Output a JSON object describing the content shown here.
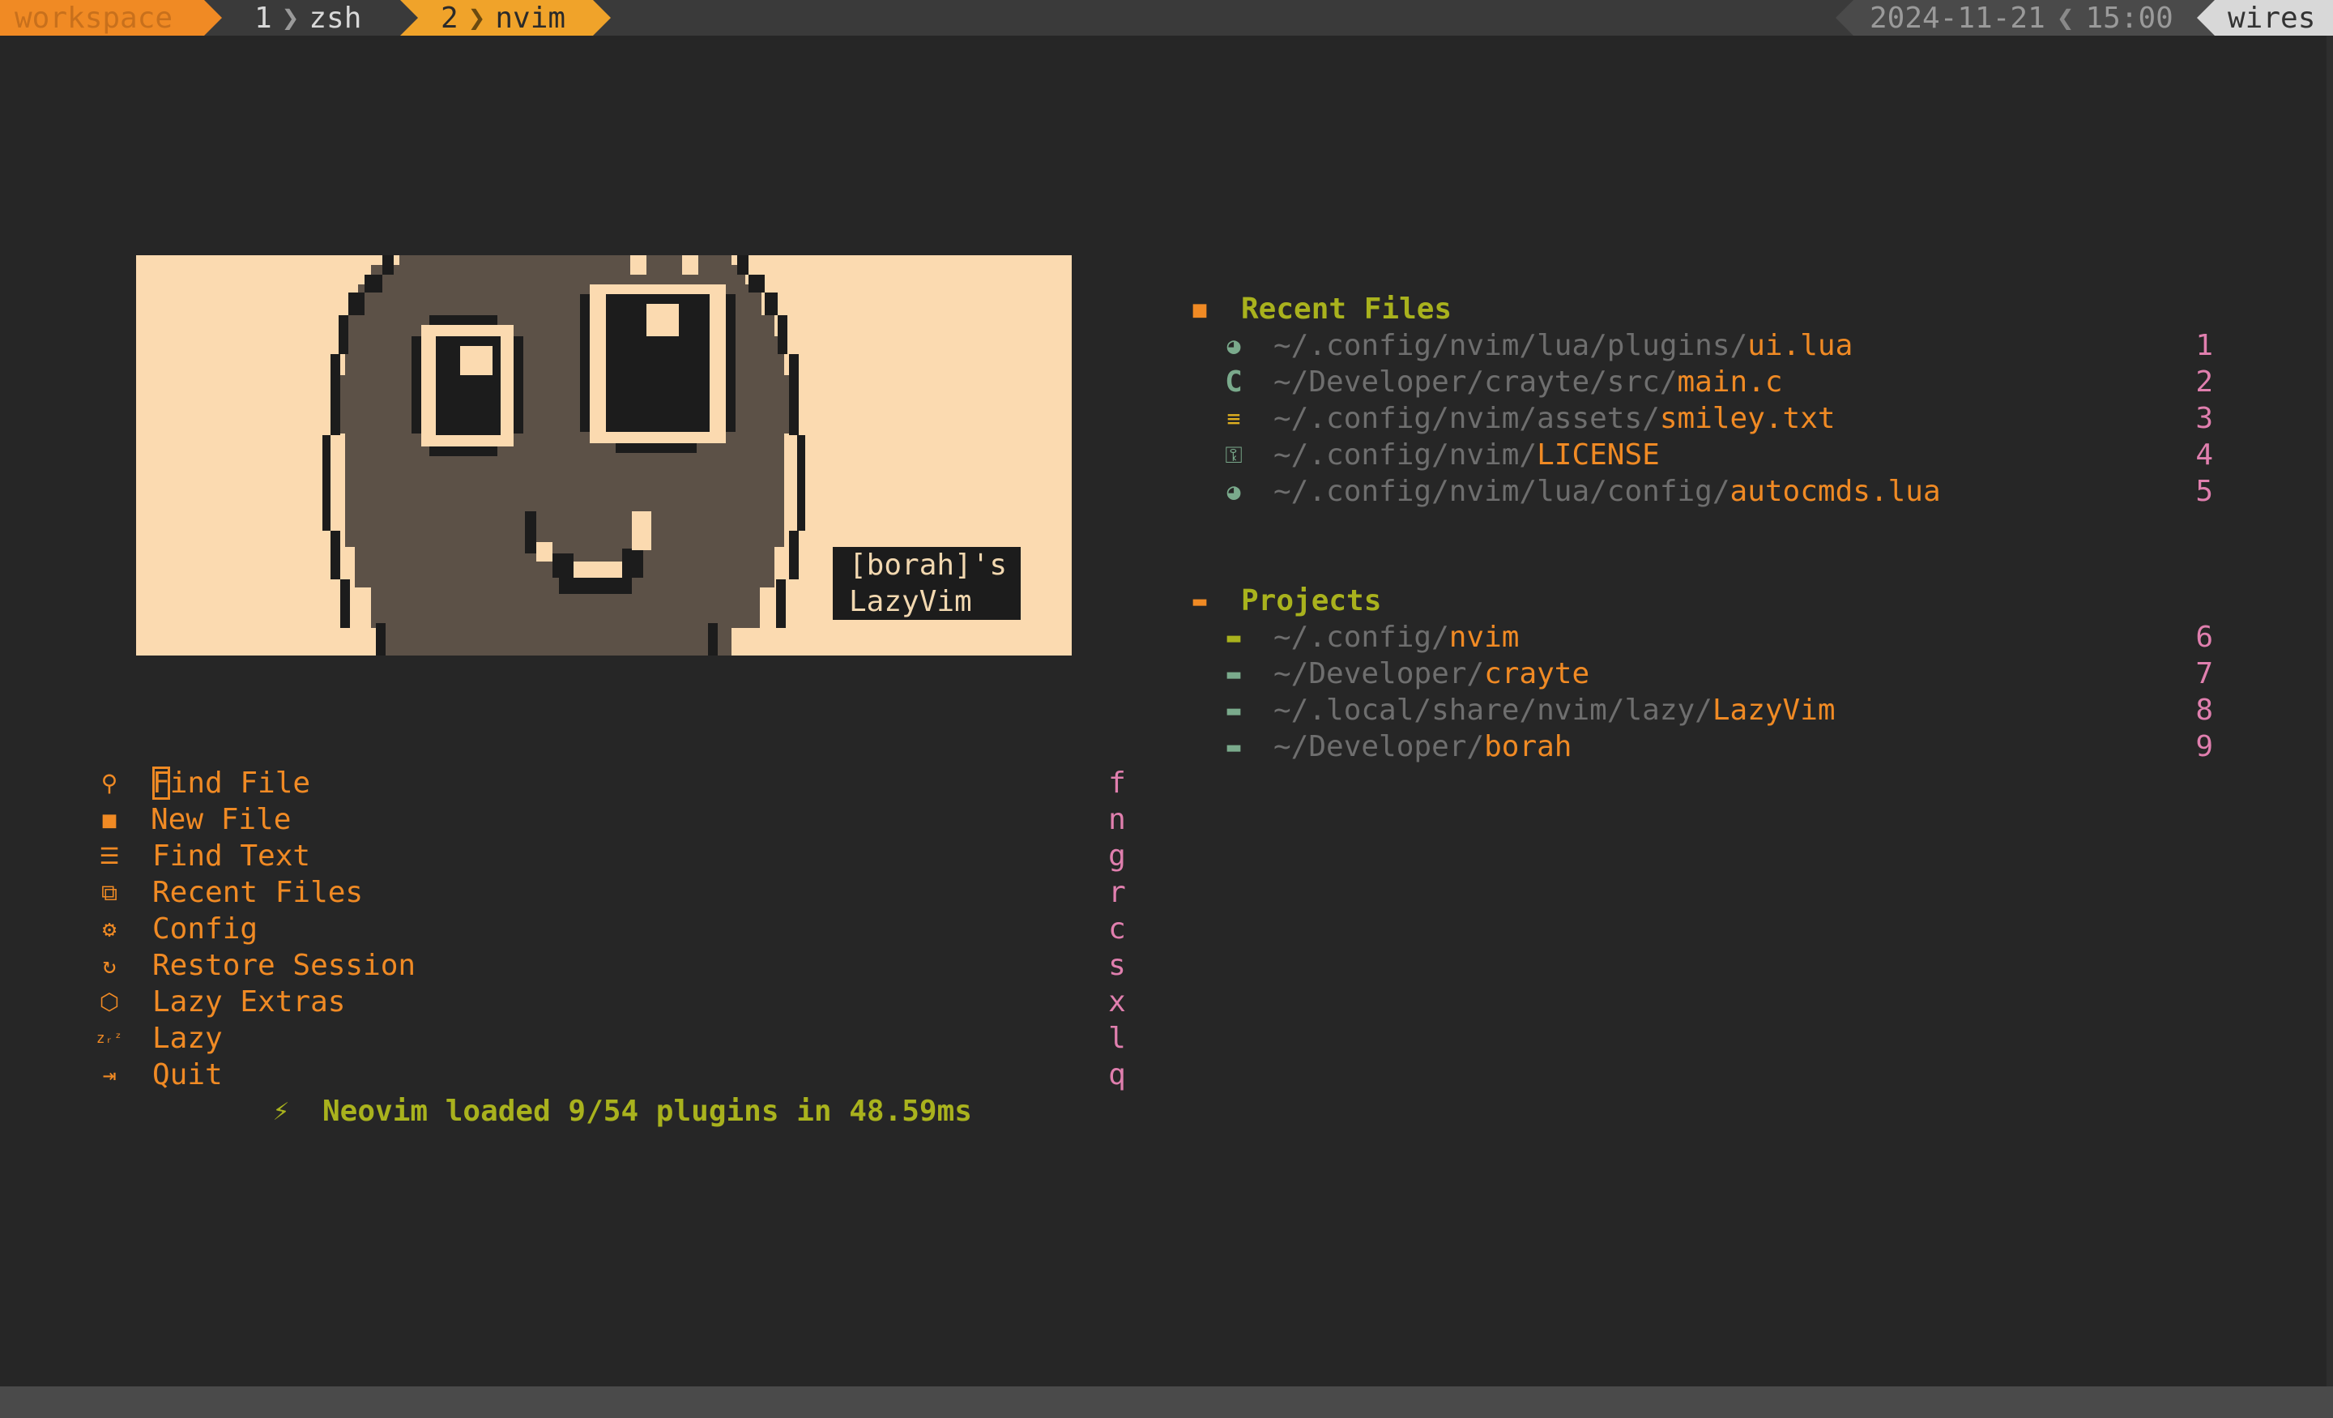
{
  "tmux": {
    "session": "workspace",
    "windows": [
      {
        "index": "1",
        "name": "zsh"
      },
      {
        "index": "2",
        "name": "nvim"
      }
    ],
    "date": "2024-11-21",
    "time": "15:00",
    "host": "wires"
  },
  "header": {
    "banner_tag_line1": "[borah]'s",
    "banner_tag_line2": "LazyVim"
  },
  "menu": [
    {
      "icon": "search-icon",
      "label": "Find File",
      "key": "f"
    },
    {
      "icon": "new-file-icon",
      "label": "New File",
      "key": "n"
    },
    {
      "icon": "text-icon",
      "label": "Find Text",
      "key": "g"
    },
    {
      "icon": "recent-files-icon",
      "label": "Recent Files",
      "key": "r"
    },
    {
      "icon": "gear-icon",
      "label": "Config",
      "key": "c"
    },
    {
      "icon": "restore-icon",
      "label": "Restore Session",
      "key": "s"
    },
    {
      "icon": "package-icon",
      "label": "Lazy Extras",
      "key": "x"
    },
    {
      "icon": "sleep-icon",
      "label": "Lazy",
      "key": "l"
    },
    {
      "icon": "quit-icon",
      "label": "Quit",
      "key": "q"
    }
  ],
  "startup": {
    "icon": "lightning-icon",
    "text": "Neovim loaded 9/54 plugins in 48.59ms"
  },
  "recent_files": {
    "icon": "file-icon",
    "title": "Recent Files",
    "items": [
      {
        "icon": "lua-icon",
        "dir": "~/.config/nvim/lua/plugins/",
        "file": "ui.lua",
        "key": "1"
      },
      {
        "icon": "c-language-icon",
        "dir": "~/Developer/crayte/src/",
        "file": "main.c",
        "key": "2"
      },
      {
        "icon": "text-file-icon",
        "dir": "~/.config/nvim/assets/",
        "file": "smiley.txt",
        "key": "3"
      },
      {
        "icon": "license-icon",
        "dir": "~/.config/nvim/",
        "file": "LICENSE",
        "key": "4"
      },
      {
        "icon": "lua-icon",
        "dir": "~/.config/nvim/lua/config/",
        "file": "autocmds.lua",
        "key": "5"
      }
    ]
  },
  "projects": {
    "icon": "folder-open-icon",
    "title": "Projects",
    "items": [
      {
        "icon": "folder-icon",
        "dir": "~/.config/",
        "name": "nvim",
        "key": "6"
      },
      {
        "icon": "folder-icon",
        "dir": "~/Developer/",
        "name": "crayte",
        "key": "7"
      },
      {
        "icon": "folder-icon",
        "dir": "~/.local/share/nvim/lazy/",
        "name": "LazyVim",
        "key": "8"
      },
      {
        "icon": "folder-icon",
        "dir": "~/Developer/",
        "name": "borah",
        "key": "9"
      }
    ]
  },
  "colors": {
    "background": "#262626",
    "accent": "#f08a24",
    "keys": "#e07fae",
    "headings": "#a9b21d",
    "banner_bg": "#fbdab0",
    "banner_face": "#5c5147"
  }
}
